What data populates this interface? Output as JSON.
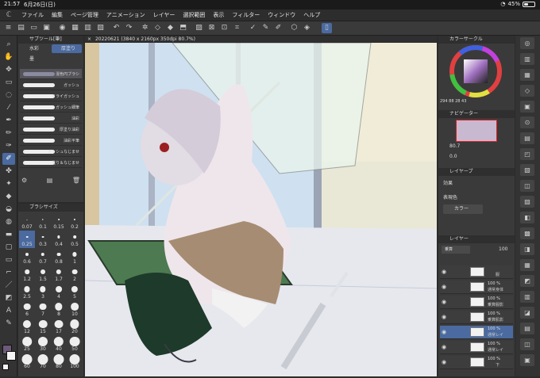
{
  "status": {
    "time": "21:57",
    "date": "6月26日(日)",
    "battery": "45%",
    "battery_level": 0.45
  },
  "menu": [
    "ファイル",
    "編集",
    "ページ管理",
    "アニメーション",
    "レイヤー",
    "選択範囲",
    "表示",
    "フィルター",
    "ウィンドウ",
    "ヘルプ"
  ],
  "subtool": {
    "title": "サブツール[筆]",
    "tabs": [
      "水彩",
      "厚塗り",
      "墨"
    ],
    "brushes": [
      "混色円ブラシ",
      "ガッシュ",
      "ドライガッシュ",
      "ガッシュ細筆",
      "油彩",
      "厚塗り油彩",
      "油彩平筆",
      "ガッシュなじませ",
      "塗り＆なじませ"
    ],
    "active_brush": "混色円ブラシ"
  },
  "brushsize": {
    "title": "ブラシサイズ",
    "sizes": [
      "0.07",
      "0.1",
      "0.15",
      "0.2",
      "0.25",
      "0.3",
      "0.4",
      "0.5",
      "0.6",
      "0.7",
      "0.8",
      "1",
      "1.2",
      "1.5",
      "1.7",
      "2",
      "2.5",
      "3",
      "4",
      "5",
      "6",
      "7",
      "8",
      "10",
      "12",
      "15",
      "17",
      "20",
      "25",
      "30",
      "40",
      "50",
      "60",
      "70",
      "80",
      "100"
    ],
    "active": "0.25"
  },
  "document": {
    "tab": "20220621 (3840 x 2160px 350dpi 80.7%)"
  },
  "color_circle": {
    "title": "カラーサークル",
    "readout": "294 88 28 43"
  },
  "navigator": {
    "title": "ナビゲーター",
    "zoom": "80.7",
    "angle": "0.0"
  },
  "layer_property": {
    "title": "レイヤープ",
    "effect_label": "効果",
    "color_label": "表現色",
    "color_value": "カラー"
  },
  "layers": {
    "title": "レイヤー",
    "blend": "乗算",
    "opacity": "100",
    "items": [
      {
        "pct": "",
        "mode": "",
        "name": "服"
      },
      {
        "pct": "100 %",
        "mode": "通常",
        "name": "身体"
      },
      {
        "pct": "100 %",
        "mode": "乗算",
        "name": "服影"
      },
      {
        "pct": "100 %",
        "mode": "乗算",
        "name": "肌影"
      },
      {
        "pct": "100 %",
        "mode": "通常",
        "name": "レイ"
      },
      {
        "pct": "100 %",
        "mode": "通常",
        "name": "レイ"
      },
      {
        "pct": "100 %",
        "mode": "",
        "name": "下"
      }
    ]
  }
}
